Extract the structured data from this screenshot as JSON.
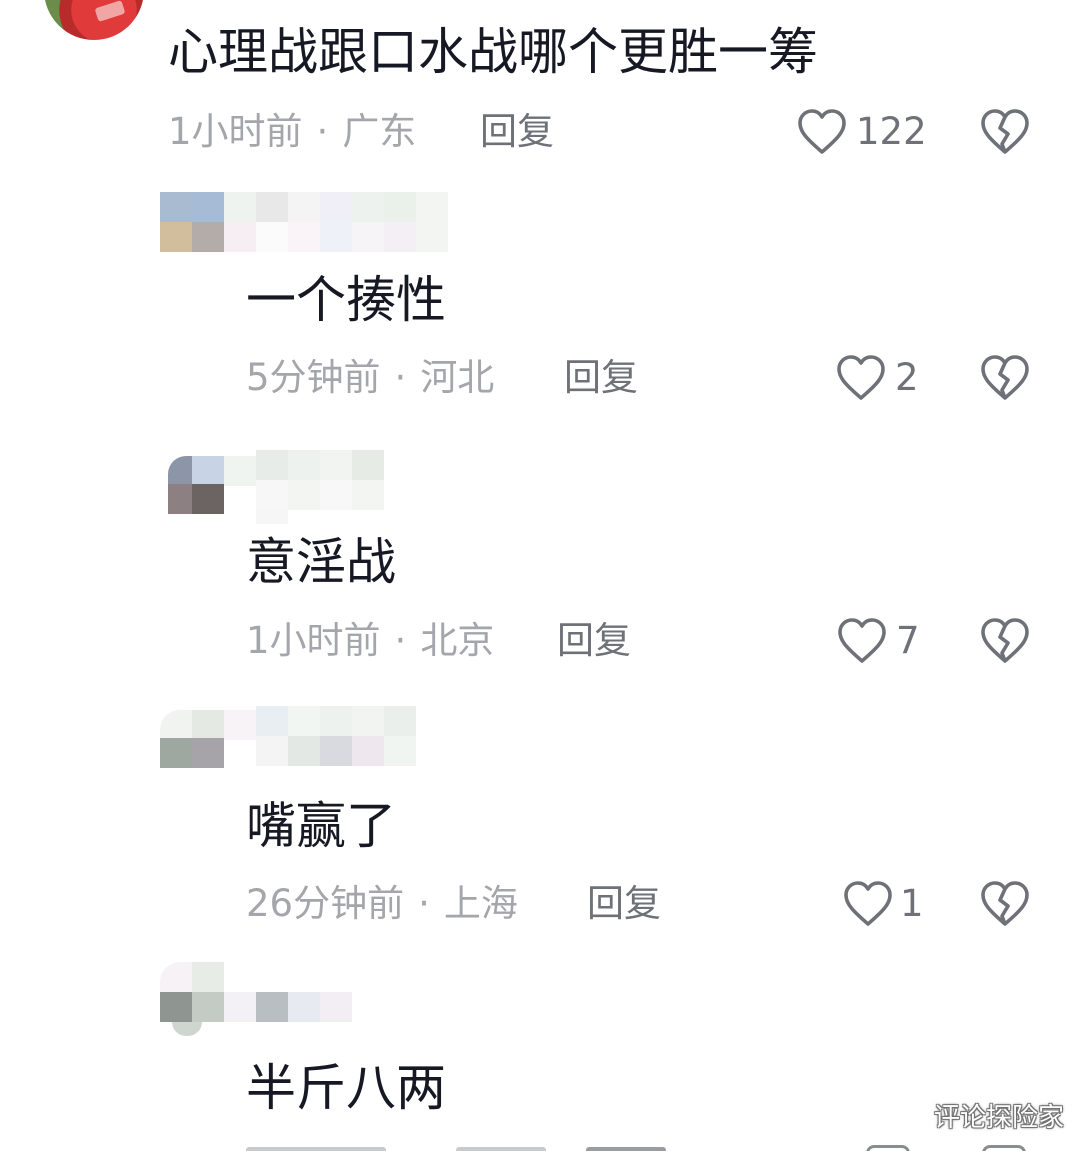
{
  "icons": {
    "like": "heart-outline-icon",
    "dislike": "broken-heart-icon"
  },
  "colors": {
    "text": "#161823",
    "meta": "#a4a6ab",
    "action": "#6e7178"
  },
  "top_comment": {
    "text": "心理战跟口水战哪个更胜一筹",
    "time": "1小时前",
    "location": "广东",
    "reply_label": "回复",
    "likes": "122"
  },
  "replies": [
    {
      "text": "一个揍性",
      "time": "5分钟前",
      "location": "河北",
      "reply_label": "回复",
      "likes": "2"
    },
    {
      "text": "意淫战",
      "time": "1小时前",
      "location": "北京",
      "reply_label": "回复",
      "likes": "7"
    },
    {
      "text": "嘴赢了",
      "time": "26分钟前",
      "location": "上海",
      "reply_label": "回复",
      "likes": "1"
    },
    {
      "text": "半斤八两"
    }
  ],
  "separator": "·",
  "watermark": "评论探险家"
}
